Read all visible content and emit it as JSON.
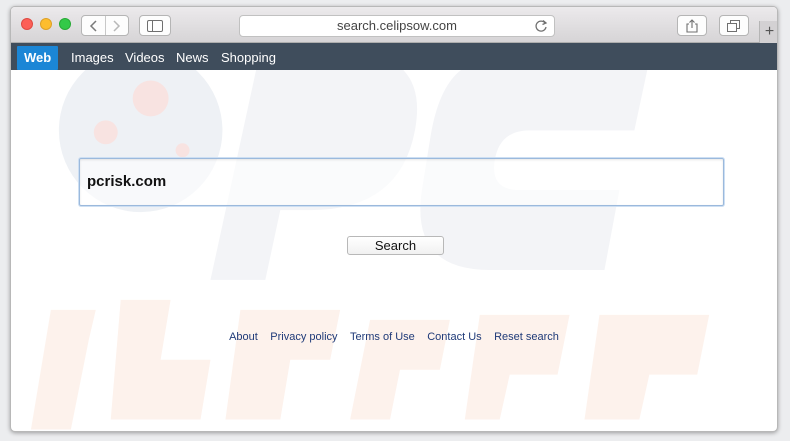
{
  "browser": {
    "url": "search.celipsow.com",
    "new_tab_symbol": "+"
  },
  "nav": {
    "items": [
      "Web",
      "Images",
      "Videos",
      "News",
      "Shopping"
    ],
    "active": "Web"
  },
  "search": {
    "value": "pcrisk.com",
    "button_label": "Search"
  },
  "footer": {
    "links": [
      "About",
      "Privacy policy",
      "Terms of Use",
      "Contact Us",
      "Reset search"
    ]
  },
  "colors": {
    "nav_bg": "#3f4d5c",
    "active_tab": "#1b86d6",
    "link": "#1f3a78"
  }
}
